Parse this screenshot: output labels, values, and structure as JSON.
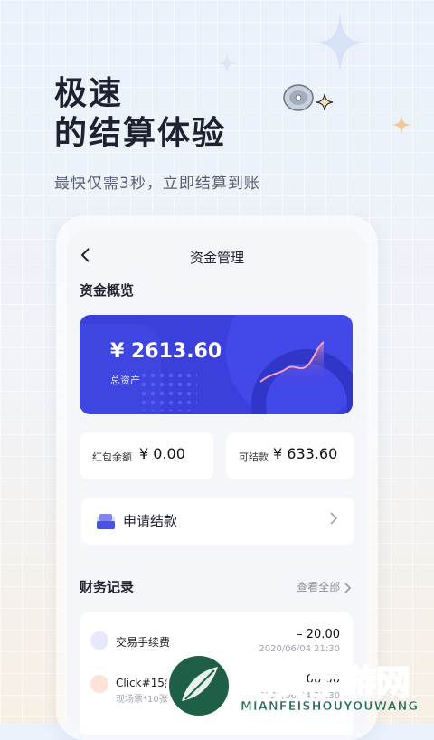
{
  "hero": {
    "title_line1": "极速",
    "title_line2": "的结算体验",
    "subtitle": "最快仅需3秒，立即结算到账"
  },
  "app": {
    "back_icon": "back-arrow-icon",
    "title": "资金管理",
    "overview_title": "资金概览",
    "total_amount": "¥ 2613.60",
    "total_label": "总资产",
    "red_packet": {
      "label": "红包余额",
      "value": "¥ 0.00"
    },
    "settleable": {
      "label": "可结款",
      "value": "¥ 633.60"
    },
    "apply_label": "申请结款",
    "records_title": "财务记录",
    "view_all": "查看全部",
    "records": [
      {
        "name": "交易手续费",
        "amount": "– 20.00",
        "time": "2020/06/04  21:30"
      },
      {
        "name": "Click#15疯",
        "sub": "现场票*10张",
        "amount": "+ 1000.00",
        "time": "2020/06/04  21:30"
      }
    ]
  },
  "watermark": {
    "title": "免费手游网",
    "subtitle": "MIANFEISHOUYOUWANG"
  },
  "colors": {
    "accent": "#3b40dd",
    "watermark_green": "#2a6f52"
  }
}
